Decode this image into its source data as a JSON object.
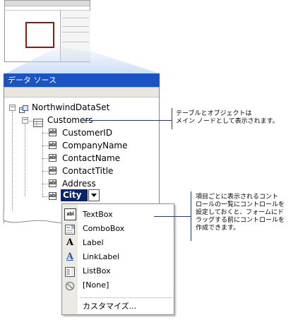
{
  "window": {
    "title": "データ ソース"
  },
  "tree": {
    "root": "NorthwindDataSet",
    "table": "Customers",
    "fields": [
      "CustomerID",
      "CompanyName",
      "ContactName",
      "ContactTitle",
      "Address"
    ],
    "selected_field": "City",
    "field_icon_text": "abl"
  },
  "menu": {
    "items": [
      {
        "label": "TextBox",
        "icon": "textbox-icon"
      },
      {
        "label": "ComboBox",
        "icon": "combobox-icon"
      },
      {
        "label": "Label",
        "icon": "label-icon"
      },
      {
        "label": "LinkLabel",
        "icon": "linklabel-icon"
      },
      {
        "label": "ListBox",
        "icon": "listbox-icon"
      },
      {
        "label": "[None]",
        "icon": "none-icon"
      }
    ],
    "customize": "カスタマイズ...",
    "label_glyph": "A"
  },
  "callouts": {
    "top": [
      "テーブルとオブジェクトは",
      "メイン ノードとして表示されます。"
    ],
    "bottom": [
      "項目ごとに表示されるコント",
      "ロールの一覧にコントロールを",
      "設定しておくと、フォームにド",
      "ラッグする前にコントロールを",
      "作成できます。"
    ]
  },
  "colors": {
    "title_bar": "#1a54c4",
    "selection": "#0a246a",
    "callout_line": "#27396e",
    "thumbnail_highlight": "#8b1a10"
  }
}
